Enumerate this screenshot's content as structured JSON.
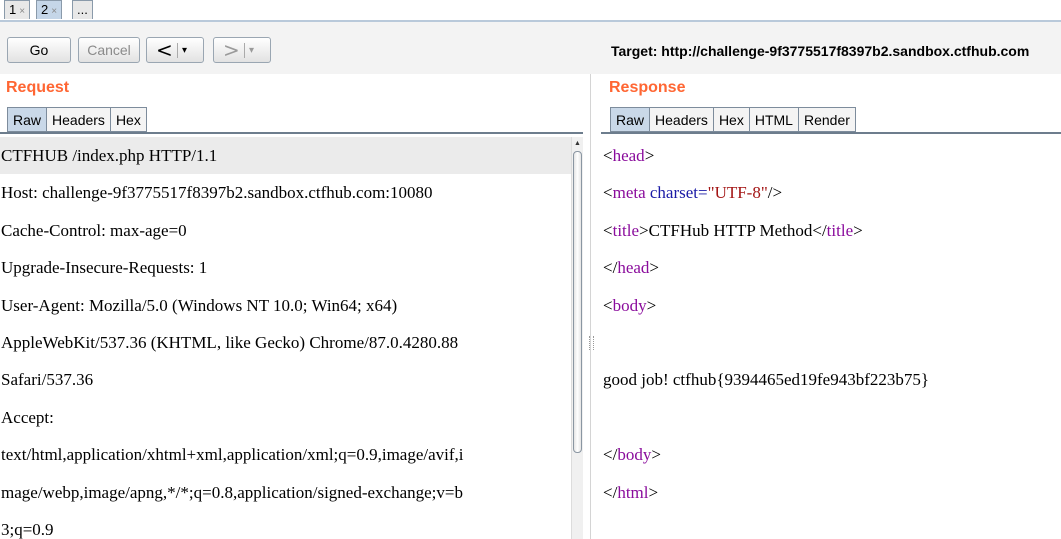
{
  "tabs": [
    {
      "label": "1",
      "close": "×"
    },
    {
      "label": "2",
      "close": "×"
    },
    {
      "label": "..."
    }
  ],
  "toolbar": {
    "go_label": "Go",
    "cancel_label": "Cancel",
    "back_arrow": "<",
    "forward_arrow": ">",
    "dropdown_glyph": "▾",
    "target": "Target: http://challenge-9f3775517f8397b2.sandbox.ctfhub.com"
  },
  "request": {
    "title": "Request",
    "tabs": [
      "Raw",
      "Headers",
      "Hex"
    ],
    "lines": [
      "CTFHUB /index.php HTTP/1.1",
      "Host: challenge-9f3775517f8397b2.sandbox.ctfhub.com:10080",
      "Cache-Control: max-age=0",
      "Upgrade-Insecure-Requests: 1",
      "User-Agent: Mozilla/5.0 (Windows NT 10.0; Win64; x64)",
      "AppleWebKit/537.36 (KHTML, like Gecko) Chrome/87.0.4280.88",
      "Safari/537.36",
      "Accept:",
      "text/html,application/xhtml+xml,application/xml;q=0.9,image/avif,i",
      "mage/webp,image/apng,*/*;q=0.8,application/signed-exchange;v=b",
      "3;q=0.9"
    ]
  },
  "response": {
    "title": "Response",
    "tabs": [
      "Raw",
      "Headers",
      "Hex",
      "HTML",
      "Render"
    ],
    "head_open": {
      "lt": "<",
      "tag": "head",
      "gt": ">"
    },
    "meta": {
      "lt": "<",
      "tag": "meta",
      "attr": " charset=",
      "value": "\"UTF-8\"",
      "end": "/>"
    },
    "title_line": {
      "lt": "<",
      "tag": "title",
      "gt": ">",
      "text": "CTFHub HTTP Method",
      "close_lt": "</",
      "close_tag": "title",
      "close_gt": ">"
    },
    "head_close": {
      "lt": "</",
      "tag": "head",
      "gt": ">"
    },
    "body_open": {
      "lt": "<",
      "tag": "body",
      "gt": ">"
    },
    "content": "good job! ctfhub{9394465ed19fe943bf223b75}",
    "body_close": {
      "lt": "</",
      "tag": "body",
      "gt": ">"
    },
    "html_close": {
      "lt": "</",
      "tag": "html",
      "gt": ">"
    }
  },
  "colors": {
    "section_title": "#ff6633",
    "tag": "#8a0c9c",
    "attribute": "#1a1aa6",
    "attribute_value": "#a31515",
    "active_tab": "#c9d8e8"
  }
}
